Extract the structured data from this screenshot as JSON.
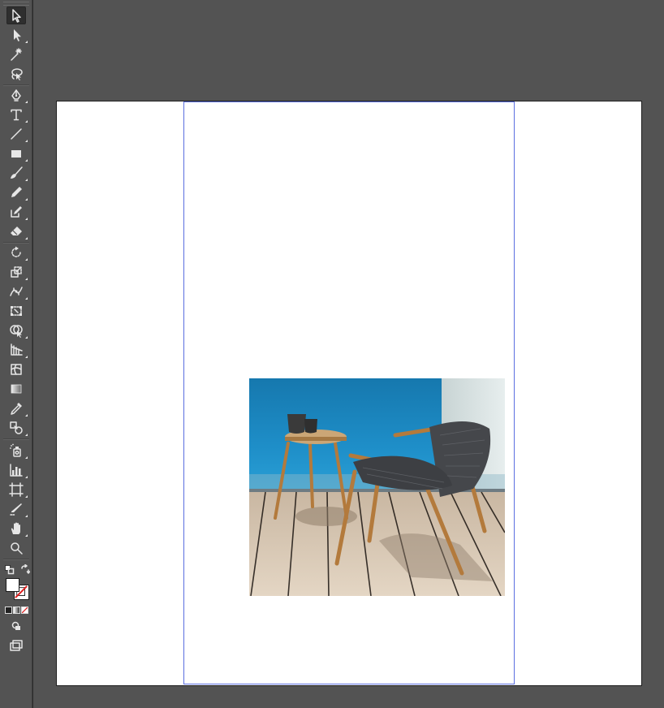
{
  "app": "vector-illustration-editor",
  "toolbar": {
    "tools": [
      {
        "name": "selection-tool",
        "active": true
      },
      {
        "name": "direct-selection-tool"
      },
      {
        "name": "magic-wand-tool"
      },
      {
        "name": "lasso-tool"
      },
      {
        "name": "pen-tool"
      },
      {
        "name": "type-tool",
        "glyph": "T"
      },
      {
        "name": "line-segment-tool"
      },
      {
        "name": "rectangle-tool"
      },
      {
        "name": "paintbrush-tool"
      },
      {
        "name": "pencil-tool"
      },
      {
        "name": "blob-brush-tool"
      },
      {
        "name": "eraser-tool"
      },
      {
        "name": "rotate-tool"
      },
      {
        "name": "scale-tool"
      },
      {
        "name": "width-tool"
      },
      {
        "name": "free-transform-tool"
      },
      {
        "name": "shape-builder-tool"
      },
      {
        "name": "perspective-grid-tool"
      },
      {
        "name": "mesh-tool"
      },
      {
        "name": "gradient-tool"
      },
      {
        "name": "eyedropper-tool"
      },
      {
        "name": "blend-tool"
      },
      {
        "name": "symbol-sprayer-tool"
      },
      {
        "name": "column-graph-tool"
      },
      {
        "name": "artboard-tool"
      },
      {
        "name": "slice-tool"
      },
      {
        "name": "hand-tool"
      },
      {
        "name": "zoom-tool"
      }
    ],
    "fill_color": "#ffffff",
    "stroke_color": "none"
  },
  "document": {
    "artboard_color": "#ffffff",
    "guide_color": "#5b6fe0",
    "placed_image": "outdoor-teak-chair-and-side-table-on-deck-by-sea"
  }
}
